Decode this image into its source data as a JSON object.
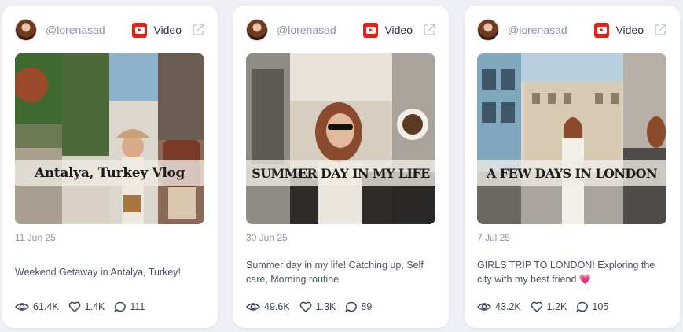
{
  "cards": [
    {
      "handle": "@lorenasad",
      "platform_label": "Video",
      "thumbnail_title": "Antalya, Turkey Vlog",
      "date": "11 Jun 25",
      "caption": "Weekend Getaway in Antalya, Turkey!",
      "views": "61.4K",
      "likes": "1.4K",
      "comments": "111"
    },
    {
      "handle": "@lorenasad",
      "platform_label": "Video",
      "thumbnail_title": "SUMMER DAY IN MY LIFE",
      "date": "30 Jun 25",
      "caption": "Summer day in my life! Catching up, Self care, Morning routine",
      "views": "49.6K",
      "likes": "1.3K",
      "comments": "89"
    },
    {
      "handle": "@lorenasad",
      "platform_label": "Video",
      "thumbnail_title": "A FEW DAYS IN LONDON",
      "date": "7 Jul 25",
      "caption": "GIRLS TRIP TO LONDON! Exploring the city with my best friend 💗",
      "views": "43.2K",
      "likes": "1.2K",
      "comments": "105"
    }
  ],
  "icons": {
    "platform": "youtube-icon",
    "open": "external-link-icon",
    "views": "eye-icon",
    "likes": "heart-icon",
    "comments": "comment-icon"
  },
  "colors": {
    "page_background": "#eef0f5",
    "card_background": "#ffffff",
    "youtube_red": "#e62117",
    "muted_text": "#8b93a7",
    "body_text": "#4a5266"
  }
}
